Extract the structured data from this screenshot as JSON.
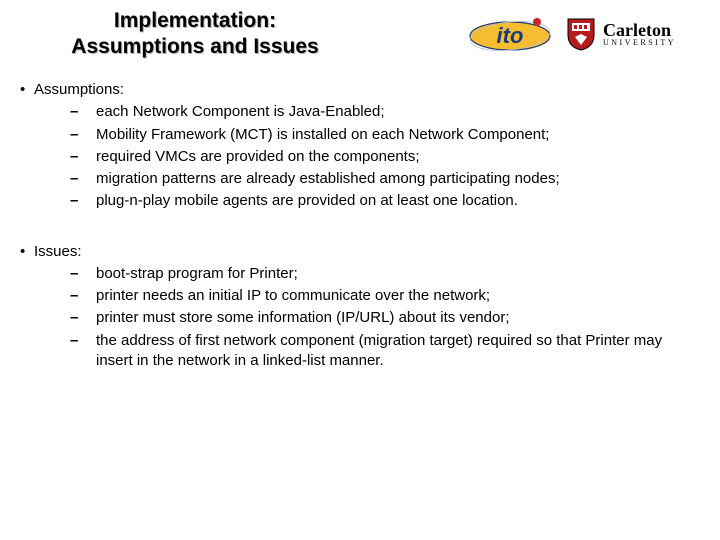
{
  "title_line1": "Implementation:",
  "title_line2": "Assumptions and Issues",
  "logos": {
    "ito_label": "ito",
    "carleton_main": "Carleton",
    "carleton_sub": "UNIVERSITY"
  },
  "sections": [
    {
      "heading": "Assumptions:",
      "items": [
        "each Network Component is Java-Enabled;",
        "Mobility Framework (MCT) is installed on each Network Component;",
        "required VMCs are provided on the components;",
        "migration patterns are already established among participating nodes;",
        "plug-n-play mobile agents are provided on at least one location."
      ]
    },
    {
      "heading": "Issues:",
      "items": [
        "boot-strap program for Printer;",
        "printer needs an initial IP to communicate over the network;",
        "printer must store some information (IP/URL) about its vendor;",
        "the address of first network component (migration target) required so that Printer may  insert in the network in a linked-list manner."
      ]
    }
  ],
  "glyphs": {
    "dot": "•",
    "dash": "–"
  }
}
